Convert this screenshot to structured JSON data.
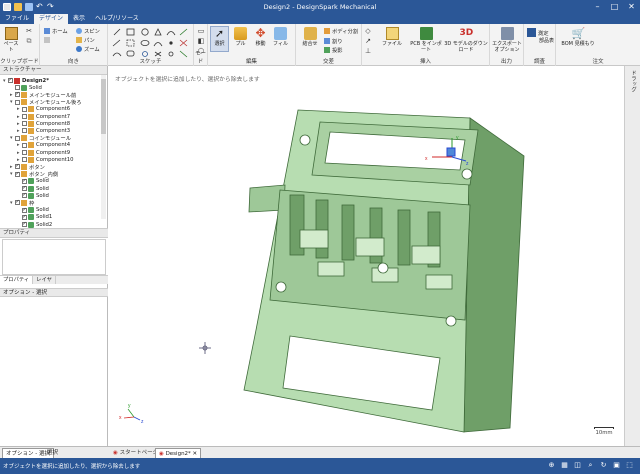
{
  "window": {
    "title": "Design2 - DesignSpark Mechanical"
  },
  "tabs": [
    "ファイル",
    "デザイン",
    "表示",
    "ヘルプ/リソース"
  ],
  "ribbon": {
    "clipboard": {
      "paste": "ペースト",
      "label": "クリップボード"
    },
    "orient": {
      "home": "ホーム",
      "pan": "パン",
      "zoom": "ズーム",
      "spin": "スピン",
      "label": "向き"
    },
    "sketch": {
      "label": "スケッチ"
    },
    "mode": {
      "label": "モード"
    },
    "edit": {
      "select": "選択",
      "pull": "プル",
      "move": "移動",
      "fill": "フィル",
      "label": "編集"
    },
    "intersect": {
      "combine": "結合せ",
      "split_body": "ボディ分割",
      "split": "割り",
      "project": "投影",
      "label": "交差"
    },
    "insert": {
      "file": "ファイル",
      "pcb": "PCB をインポート",
      "download": "3D モデルのダウンロード",
      "label": "挿入"
    },
    "output": {
      "export": "エクスポート",
      "options": "オプション",
      "label": "出力"
    },
    "investigate": {
      "measure": "測定",
      "label": "調査"
    },
    "bom": {
      "parts": "部品表",
      "order": "BOM 見積もり",
      "label": "注文"
    }
  },
  "structure": {
    "header": "ストラクチャー",
    "items": [
      {
        "label": "Design2*",
        "indent": 0,
        "expand": "▾",
        "checked": true,
        "icon": "design"
      },
      {
        "label": "Solid",
        "indent": 1,
        "expand": "",
        "checked": false,
        "icon": "solid"
      },
      {
        "label": "メインモジュール前",
        "indent": 1,
        "expand": "▸",
        "checked": true,
        "icon": "component"
      },
      {
        "label": "メインモジュール後ろ",
        "indent": 1,
        "expand": "▾",
        "checked": false,
        "icon": "component"
      },
      {
        "label": "Component6",
        "indent": 2,
        "expand": "▸",
        "checked": false,
        "icon": "component"
      },
      {
        "label": "Component7",
        "indent": 2,
        "expand": "▸",
        "checked": false,
        "icon": "component"
      },
      {
        "label": "Component8",
        "indent": 2,
        "expand": "▸",
        "checked": false,
        "icon": "component"
      },
      {
        "label": "Component3",
        "indent": 2,
        "expand": "▸",
        "checked": false,
        "icon": "component"
      },
      {
        "label": "コインモジュール",
        "indent": 1,
        "expand": "▾",
        "checked": false,
        "icon": "component"
      },
      {
        "label": "Component4",
        "indent": 2,
        "expand": "▸",
        "checked": false,
        "icon": "component"
      },
      {
        "label": "Component9",
        "indent": 2,
        "expand": "▸",
        "checked": false,
        "icon": "component"
      },
      {
        "label": "Component10",
        "indent": 2,
        "expand": "▸",
        "checked": false,
        "icon": "component"
      },
      {
        "label": "ボタン",
        "indent": 1,
        "expand": "▸",
        "checked": true,
        "icon": "component"
      },
      {
        "label": "ボタン_内側",
        "indent": 1,
        "expand": "▾",
        "checked": true,
        "icon": "component"
      },
      {
        "label": "Solid",
        "indent": 2,
        "expand": "",
        "checked": true,
        "icon": "solid"
      },
      {
        "label": "Solid",
        "indent": 2,
        "expand": "",
        "checked": true,
        "icon": "solid"
      },
      {
        "label": "Solid",
        "indent": 2,
        "expand": "",
        "checked": true,
        "icon": "solid"
      },
      {
        "label": "枠",
        "indent": 1,
        "expand": "▾",
        "checked": true,
        "icon": "component"
      },
      {
        "label": "Solid",
        "indent": 2,
        "expand": "",
        "checked": true,
        "icon": "solid"
      },
      {
        "label": "Solid1",
        "indent": 2,
        "expand": "",
        "checked": true,
        "icon": "solid"
      },
      {
        "label": "Solid2",
        "indent": 2,
        "expand": "",
        "checked": true,
        "icon": "solid"
      }
    ]
  },
  "properties": {
    "header": "プロパティ",
    "tab_properties": "プロパティ",
    "tab_layers": "レイヤ"
  },
  "options": {
    "header": "オプション - 選択"
  },
  "viewport": {
    "hint": "オブジェクトを選択に追加したり、選択から除去します",
    "scale": "10mm",
    "axis_x": "x",
    "axis_y": "y",
    "axis_z": "z"
  },
  "rightpanel": {
    "label": "ドラッグ"
  },
  "bottom_tabs": [
    "オプション - 選択",
    "選択",
    "スタートページ",
    "Design2*"
  ],
  "status": {
    "message": "オブジェクトを選択に追加したり、選択から除去します"
  },
  "colors": {
    "accent": "#2b5797",
    "model_face": "#b7ddb1",
    "model_edge": "#3f6a3a"
  }
}
